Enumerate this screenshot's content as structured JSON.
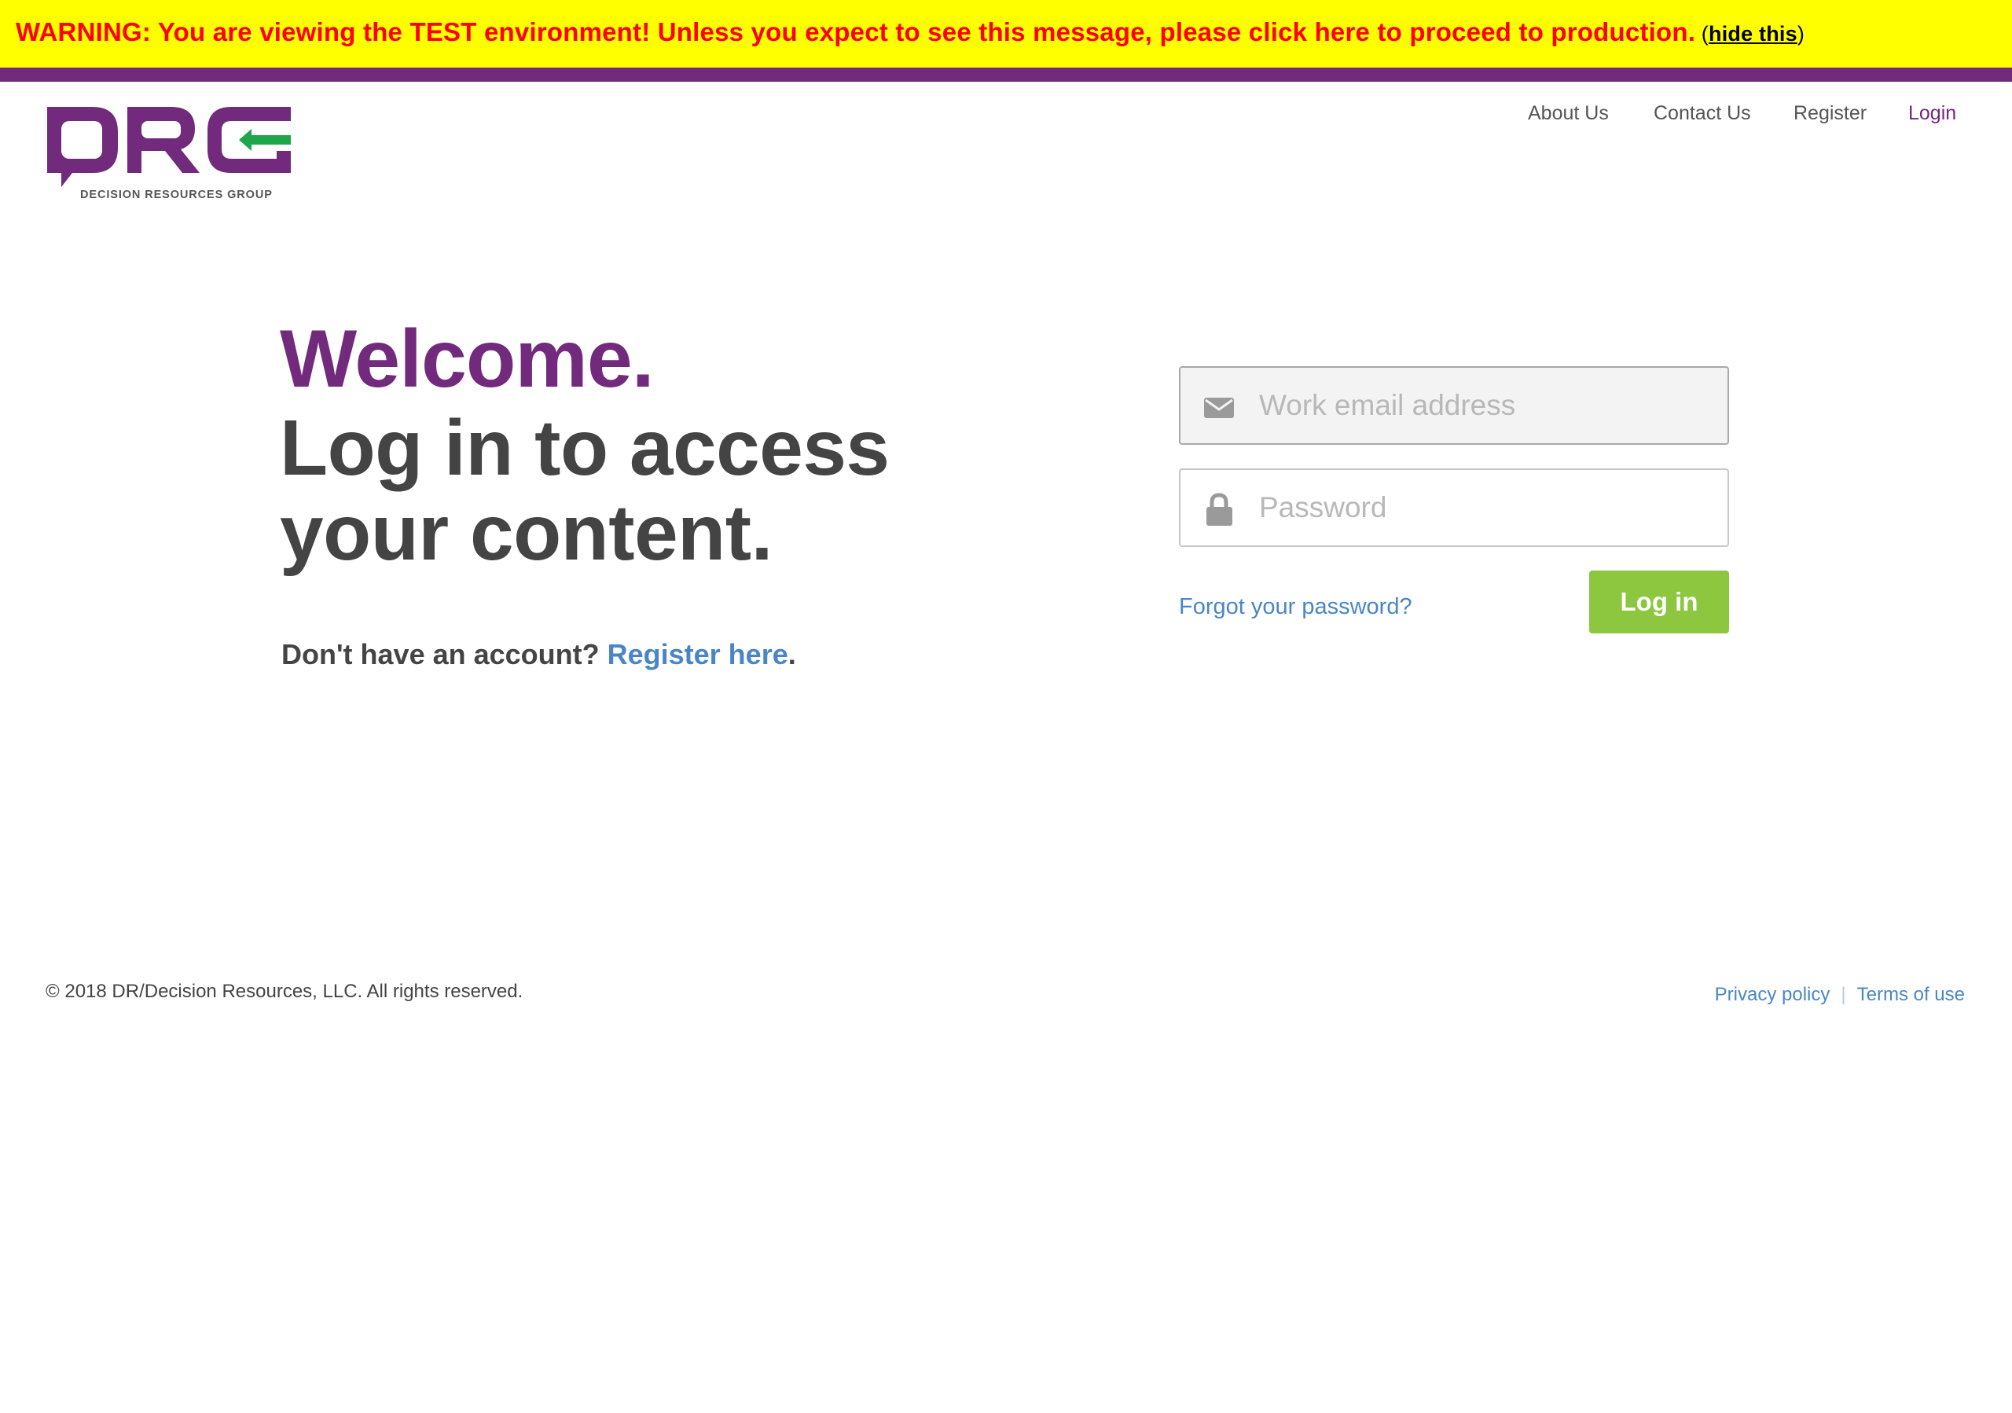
{
  "warning": {
    "message": "WARNING: You are viewing the TEST environment! Unless you expect to see this message, please click here to proceed to production.",
    "hide_open": " (",
    "hide_label": "hide this",
    "hide_close": ")"
  },
  "logo": {
    "wordmark": "DRG",
    "caption": "DECISION RESOURCES GROUP"
  },
  "nav": {
    "about": "About Us",
    "contact": "Contact Us",
    "register": "Register",
    "login": "Login"
  },
  "hero": {
    "welcome": "Welcome.",
    "tagline": "Log in to access your content.",
    "account_prompt": "Don't have an account? ",
    "register_link": "Register here",
    "register_suffix": "."
  },
  "form": {
    "email_placeholder": "Work email address",
    "email_value": "",
    "password_placeholder": "Password",
    "password_value": "",
    "forgot_label": "Forgot your password?",
    "login_label": "Log in"
  },
  "footer": {
    "copyright": "© 2018 DR/Decision Resources, LLC. All rights reserved.",
    "privacy": "Privacy policy",
    "separator": "|",
    "terms": "Terms of use"
  },
  "colors": {
    "brand_purple": "#722a7c",
    "brand_green": "#1ea64b",
    "warning_background": "#ffff00",
    "warning_text": "#ff0000",
    "link_blue": "#4a86c6",
    "button_green": "#8dc63f",
    "heading_gray": "#444444"
  },
  "icons": {
    "email_field": "envelope-icon",
    "password_field": "lock-icon",
    "logo_arrow": "arrow-left-icon"
  }
}
